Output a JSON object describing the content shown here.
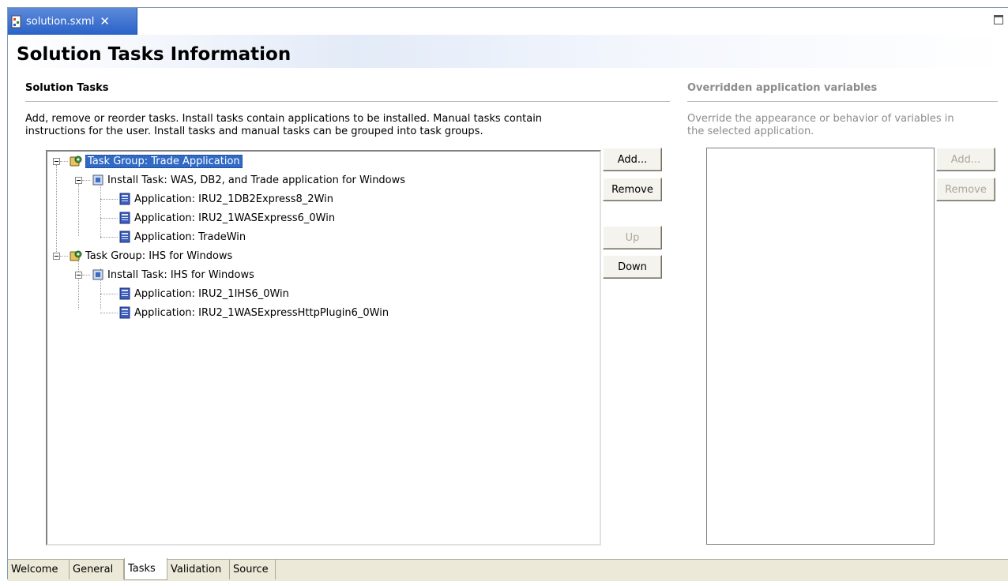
{
  "editor_tab": {
    "label": "solution.sxml",
    "close": "✕"
  },
  "page": {
    "title": "Solution Tasks Information"
  },
  "tasks_section": {
    "title": "Solution Tasks",
    "description_line1": "Add, remove or reorder tasks. Install tasks contain applications to be installed. Manual tasks contain",
    "description_line2": "instructions for the user. Install tasks and manual tasks can be grouped into task groups.",
    "tree": [
      {
        "label": "Task Group: Trade Application",
        "icon": "task-group-icon",
        "selected": true
      },
      {
        "label": "Install Task: WAS, DB2, and Trade application for Windows",
        "icon": "install-task-icon"
      },
      {
        "label": "Application: IRU2_1DB2Express8_2Win",
        "icon": "application-icon"
      },
      {
        "label": "Application: IRU2_1WASExpress6_0Win",
        "icon": "application-icon"
      },
      {
        "label": "Application: TradeWin",
        "icon": "application-icon"
      },
      {
        "label": "Task Group: IHS for Windows",
        "icon": "task-group-icon"
      },
      {
        "label": "Install Task: IHS for Windows",
        "icon": "install-task-icon"
      },
      {
        "label": "Application: IRU2_1IHS6_0Win",
        "icon": "application-icon"
      },
      {
        "label": "Application: IRU2_1WASExpressHttpPlugin6_0Win",
        "icon": "application-icon"
      }
    ],
    "buttons": {
      "add": "Add...",
      "remove": "Remove",
      "up": "Up",
      "down": "Down"
    }
  },
  "variables_section": {
    "title": "Overridden application variables",
    "description_line1": "Override the appearance or behavior of variables in",
    "description_line2": "the selected application.",
    "buttons": {
      "add": "Add...",
      "remove": "Remove"
    }
  },
  "bottom_tabs": [
    {
      "label": "Welcome"
    },
    {
      "label": "General"
    },
    {
      "label": "Tasks",
      "active": true
    },
    {
      "label": "Validation"
    },
    {
      "label": "Source"
    }
  ],
  "colors": {
    "selection": "#316ac5",
    "tab_active": "#2a62c8",
    "disabled_text": "#aca899",
    "section_title_disabled": "#8c8c8c"
  }
}
